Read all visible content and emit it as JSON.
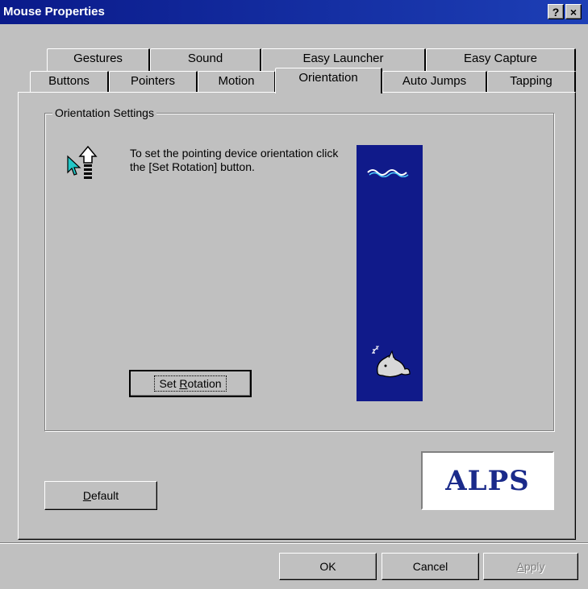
{
  "window": {
    "title": "Mouse Properties",
    "help_label": "?",
    "close_label": "×"
  },
  "tabs_row1": [
    {
      "label": "Gestures"
    },
    {
      "label": "Sound"
    },
    {
      "label": "Easy Launcher"
    },
    {
      "label": "Easy Capture"
    }
  ],
  "tabs_row2": [
    {
      "label": "Buttons"
    },
    {
      "label": "Pointers"
    },
    {
      "label": "Motion"
    },
    {
      "label": "Orientation",
      "active": true
    },
    {
      "label": "Auto Jumps"
    },
    {
      "label": "Tapping"
    }
  ],
  "group": {
    "label": "Orientation Settings",
    "instruction": "To set the pointing device orientation click the [Set Rotation] button."
  },
  "buttons": {
    "set_rotation_pre": "Set ",
    "set_rotation_key": "R",
    "set_rotation_post": "otation",
    "default_key": "D",
    "default_rest": "efault",
    "ok": "OK",
    "cancel": "Cancel",
    "apply_key": "A",
    "apply_rest": "pply"
  },
  "logo": {
    "text": "ALPS"
  },
  "colors": {
    "title_bar": "#0a1a8a",
    "preview_bg": "#101a8a",
    "logo_text": "#1a2a8a"
  },
  "icons": {
    "orientation_icon": "arrow-up-pointer-icon",
    "preview_top": "waves-icon",
    "preview_bottom": "dolphin-icon"
  }
}
